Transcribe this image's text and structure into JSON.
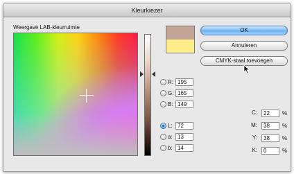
{
  "window": {
    "title": "Kleurkiezer",
    "picker_label": "Weergave LAB-kleurruimte"
  },
  "buttons": {
    "ok": "OK",
    "cancel": "Annuleren",
    "cmyk": "CMYK-staal toevoegen"
  },
  "swatches": {
    "new_color": "#c3a595",
    "old_color": "#fdec8a"
  },
  "rgb": [
    {
      "label": "R:",
      "value": "195"
    },
    {
      "label": "G:",
      "value": "165"
    },
    {
      "label": "B:",
      "value": "149"
    }
  ],
  "lab": [
    {
      "label": "L:",
      "value": "72",
      "selected": true
    },
    {
      "label": "a:",
      "value": "13"
    },
    {
      "label": "b:",
      "value": "14"
    }
  ],
  "cmyk": [
    {
      "label": "C:",
      "value": "22",
      "unit": "%"
    },
    {
      "label": "M:",
      "value": "38",
      "unit": "%"
    },
    {
      "label": "Y:",
      "value": "38",
      "unit": "%"
    },
    {
      "label": "K:",
      "value": "0",
      "unit": "%"
    }
  ]
}
